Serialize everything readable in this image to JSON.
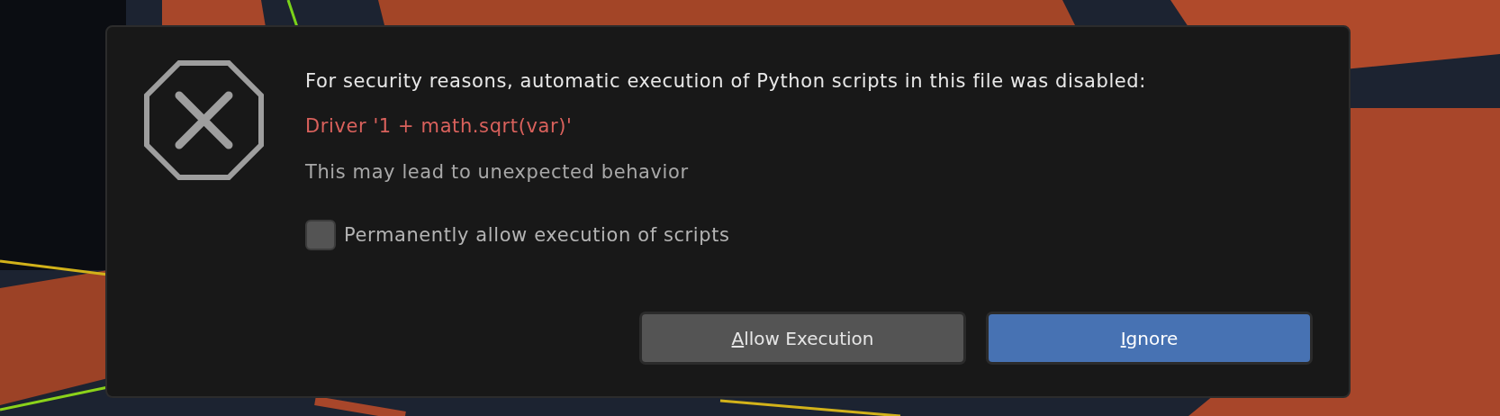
{
  "dialog": {
    "message": "For security reasons, automatic execution of Python scripts in this file was disabled:",
    "detail": "Driver '1 + math.sqrt(var)'",
    "note": "This may lead to unexpected behavior",
    "checkbox": {
      "label": "Permanently allow execution of scripts",
      "checked": false
    },
    "buttons": [
      {
        "mnemonic": "A",
        "rest": "llow Execution",
        "kind": "secondary"
      },
      {
        "mnemonic": "I",
        "rest": "gnore",
        "kind": "primary"
      }
    ]
  }
}
